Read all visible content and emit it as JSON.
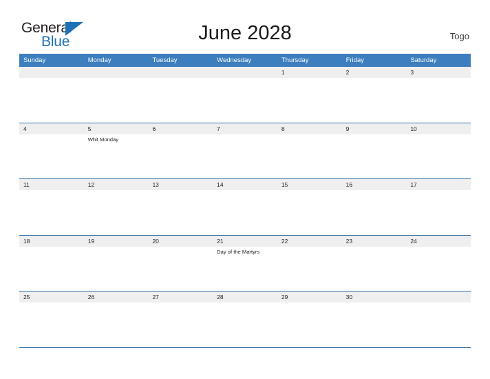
{
  "brand": {
    "name_part1": "General",
    "name_part2": "Blue",
    "triangle_color": "#1f72b5",
    "text_color": "#231f20"
  },
  "header": {
    "title": "June 2028",
    "region": "Togo"
  },
  "calendar": {
    "accent_color": "#3c7ebe",
    "rule_color": "#2e6da4",
    "date_band_color": "#efefef",
    "weekdays": [
      "Sunday",
      "Monday",
      "Tuesday",
      "Wednesday",
      "Thursday",
      "Friday",
      "Saturday"
    ],
    "weeks": [
      [
        {
          "date": "",
          "events": []
        },
        {
          "date": "",
          "events": []
        },
        {
          "date": "",
          "events": []
        },
        {
          "date": "",
          "events": []
        },
        {
          "date": "1",
          "events": []
        },
        {
          "date": "2",
          "events": []
        },
        {
          "date": "3",
          "events": []
        }
      ],
      [
        {
          "date": "4",
          "events": []
        },
        {
          "date": "5",
          "events": [
            "Whit Monday"
          ]
        },
        {
          "date": "6",
          "events": []
        },
        {
          "date": "7",
          "events": []
        },
        {
          "date": "8",
          "events": []
        },
        {
          "date": "9",
          "events": []
        },
        {
          "date": "10",
          "events": []
        }
      ],
      [
        {
          "date": "11",
          "events": []
        },
        {
          "date": "12",
          "events": []
        },
        {
          "date": "13",
          "events": []
        },
        {
          "date": "14",
          "events": []
        },
        {
          "date": "15",
          "events": []
        },
        {
          "date": "16",
          "events": []
        },
        {
          "date": "17",
          "events": []
        }
      ],
      [
        {
          "date": "18",
          "events": []
        },
        {
          "date": "19",
          "events": []
        },
        {
          "date": "20",
          "events": []
        },
        {
          "date": "21",
          "events": [
            "Day of the Martyrs"
          ]
        },
        {
          "date": "22",
          "events": []
        },
        {
          "date": "23",
          "events": []
        },
        {
          "date": "24",
          "events": []
        }
      ],
      [
        {
          "date": "25",
          "events": []
        },
        {
          "date": "26",
          "events": []
        },
        {
          "date": "27",
          "events": []
        },
        {
          "date": "28",
          "events": []
        },
        {
          "date": "29",
          "events": []
        },
        {
          "date": "30",
          "events": []
        },
        {
          "date": "",
          "events": []
        }
      ]
    ]
  }
}
